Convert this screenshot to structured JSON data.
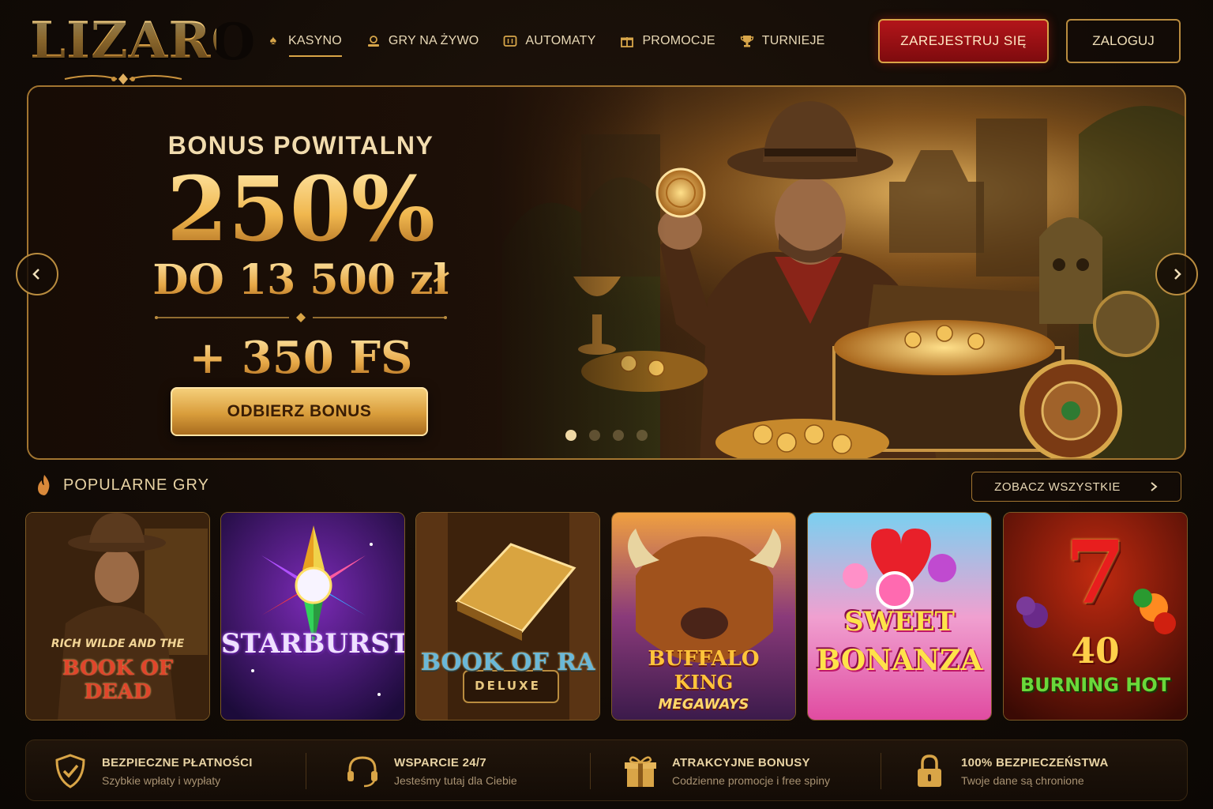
{
  "brand": {
    "logo_text": "LIZARO"
  },
  "nav": {
    "items": [
      {
        "label": "KASYNO",
        "icon": "spade-icon",
        "active": true
      },
      {
        "label": "GRY NA ŻYWO",
        "icon": "live-dealer-icon",
        "active": false
      },
      {
        "label": "AUTOMATY",
        "icon": "slot-machine-icon",
        "active": false
      },
      {
        "label": "PROMOCJE",
        "icon": "gift-icon",
        "active": false
      },
      {
        "label": "TURNIEJE",
        "icon": "trophy-icon",
        "active": false
      }
    ]
  },
  "auth": {
    "register_label": "ZAREJESTRUJ SIĘ",
    "login_label": "ZALOGUJ"
  },
  "hero": {
    "title": "BONUS POWITALNY",
    "percent": "250%",
    "amount": "DO 13 500 zł",
    "free_spins": "+ 350 FS",
    "cta_label": "ODBIERZ BONUS",
    "slides_total": 4,
    "active_slide": 1
  },
  "popular": {
    "title": "POPULARNE GRY",
    "icon": "flame-icon",
    "see_all_label": "ZOBACZ WSZYSTKIE",
    "games": [
      {
        "title_line1": "RICH WILDE AND THE",
        "title_line2": "BOOK OF DEAD"
      },
      {
        "title_line1": "STARBURST",
        "title_line2": ""
      },
      {
        "title_line1": "BOOK OF RA",
        "title_line2": "DELUXE"
      },
      {
        "title_line1": "BUFFALO",
        "title_line2": "KING",
        "title_line3": "MEGAWAYS"
      },
      {
        "title_line1": "SWEET",
        "title_line2": "BONANZA"
      },
      {
        "title_line1": "7",
        "title_line2": "40",
        "title_line3": "BURNING HOT"
      }
    ]
  },
  "features": [
    {
      "title": "BEZPIECZNE PŁATNOŚCI",
      "subtitle": "Szybkie wpłaty i wypłaty",
      "icon": "shield-check-icon"
    },
    {
      "title": "WSPARCIE 24/7",
      "subtitle": "Jesteśmy tutaj dla Ciebie",
      "icon": "headset-icon"
    },
    {
      "title": "ATRAKCYJNE BONUSY",
      "subtitle": "Codzienne promocje i free spiny",
      "icon": "gift-icon"
    },
    {
      "title": "100% BEZPIECZEŃSTWA",
      "subtitle": "Twoje dane są chronione",
      "icon": "lock-icon"
    }
  ],
  "colors": {
    "gold": "#d9a547",
    "register_red": "#9e1014",
    "background": "#120b06"
  }
}
